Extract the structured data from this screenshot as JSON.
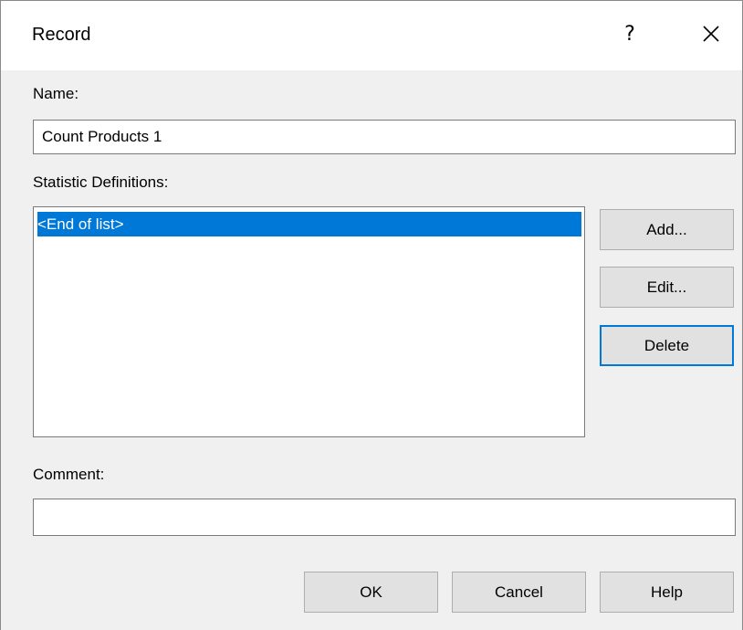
{
  "window": {
    "title": "Record",
    "help_glyph": "?",
    "close_icon": "close-icon"
  },
  "name_section": {
    "label": "Name:",
    "value": "Count Products 1"
  },
  "statistics_section": {
    "label": "Statistic Definitions:",
    "items": [
      "<End of list>"
    ],
    "selected_index": 0
  },
  "side_buttons": {
    "add": "Add...",
    "edit": "Edit...",
    "delete": "Delete"
  },
  "comment_section": {
    "label": "Comment:",
    "value": ""
  },
  "footer_buttons": {
    "ok": "OK",
    "cancel": "Cancel",
    "help": "Help"
  },
  "colors": {
    "selection": "#0078d7",
    "focus_border": "#0078d7",
    "button_face": "#e1e1e1",
    "dialog_bg": "#f0f0f0"
  }
}
